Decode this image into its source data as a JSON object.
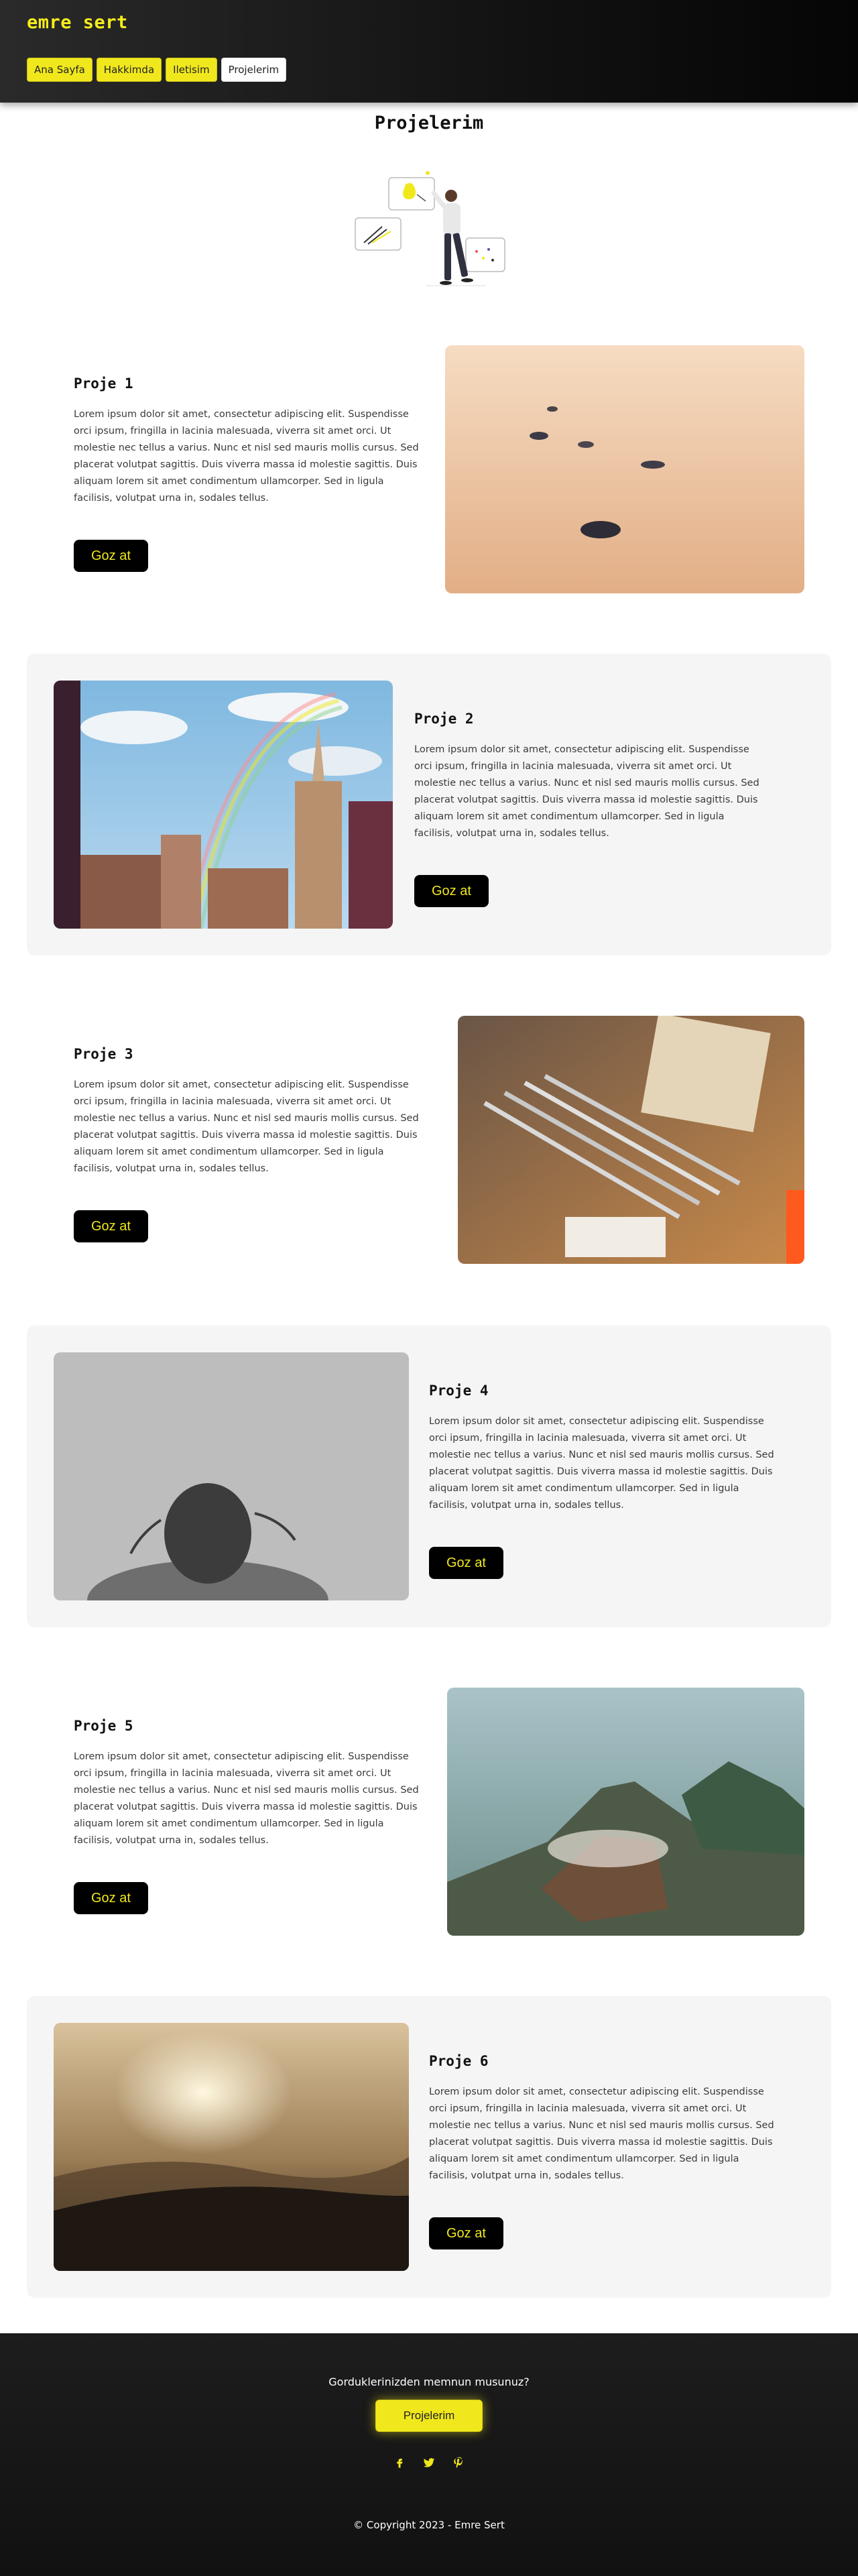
{
  "header": {
    "brand": "emre sert",
    "nav": [
      {
        "label": "Ana Sayfa"
      },
      {
        "label": "Hakkimda"
      },
      {
        "label": "Iletisim"
      },
      {
        "label": "Projelerim"
      }
    ]
  },
  "main": {
    "title": "Projelerim",
    "projects": [
      {
        "title": "Proje 1",
        "description": "Lorem ipsum dolor sit amet, consectetur adipiscing elit. Suspendisse orci ipsum, fringilla in lacinia malesuada, viverra sit amet orci. Ut molestie nec tellus a varius. Nunc et nisl sed mauris mollis cursus. Sed placerat volutpat sagittis. Duis viverra massa id molestie sagittis. Duis aliquam lorem sit amet condimentum ullamcorper. Sed in ligula facilisis, volutpat urna in, sodales tellus.",
        "button": "Goz at",
        "image": "sand-stones"
      },
      {
        "title": "Proje 2",
        "description": "Lorem ipsum dolor sit amet, consectetur adipiscing elit. Suspendisse orci ipsum, fringilla in lacinia malesuada, viverra sit amet orci. Ut molestie nec tellus a varius. Nunc et nisl sed mauris mollis cursus. Sed placerat volutpat sagittis. Duis viverra massa id molestie sagittis. Duis aliquam lorem sit amet condimentum ullamcorper. Sed in ligula facilisis, volutpat urna in, sodales tellus.",
        "button": "Goz at",
        "image": "city-rainbow"
      },
      {
        "title": "Proje 3",
        "description": "Lorem ipsum dolor sit amet, consectetur adipiscing elit. Suspendisse orci ipsum, fringilla in lacinia malesuada, viverra sit amet orci. Ut molestie nec tellus a varius. Nunc et nisl sed mauris mollis cursus. Sed placerat volutpat sagittis. Duis viverra massa id molestie sagittis. Duis aliquam lorem sit amet condimentum ullamcorper. Sed in ligula facilisis, volutpat urna in, sodales tellus.",
        "button": "Goz at",
        "image": "pens-desk"
      },
      {
        "title": "Proje 4",
        "description": "Lorem ipsum dolor sit amet, consectetur adipiscing elit. Suspendisse orci ipsum, fringilla in lacinia malesuada, viverra sit amet orci. Ut molestie nec tellus a varius. Nunc et nisl sed mauris mollis cursus. Sed placerat volutpat sagittis. Duis viverra massa id molestie sagittis. Duis aliquam lorem sit amet condimentum ullamcorper. Sed in ligula facilisis, volutpat urna in, sodales tellus.",
        "button": "Goz at",
        "image": "sad-person"
      },
      {
        "title": "Proje 5",
        "description": "Lorem ipsum dolor sit amet, consectetur adipiscing elit. Suspendisse orci ipsum, fringilla in lacinia malesuada, viverra sit amet orci. Ut molestie nec tellus a varius. Nunc et nisl sed mauris mollis cursus. Sed placerat volutpat sagittis. Duis viverra massa id molestie sagittis. Duis aliquam lorem sit amet condimentum ullamcorper. Sed in ligula facilisis, volutpat urna in, sodales tellus.",
        "button": "Goz at",
        "image": "volcano"
      },
      {
        "title": "Proje 6",
        "description": "Lorem ipsum dolor sit amet, consectetur adipiscing elit. Suspendisse orci ipsum, fringilla in lacinia malesuada, viverra sit amet orci. Ut molestie nec tellus a varius. Nunc et nisl sed mauris mollis cursus. Sed placerat volutpat sagittis. Duis viverra massa id molestie sagittis. Duis aliquam lorem sit amet condimentum ullamcorper. Sed in ligula facilisis, volutpat urna in, sodales tellus.",
        "button": "Goz at",
        "image": "hazy-sunset"
      }
    ]
  },
  "footer": {
    "question": "Gorduklerinizden memnun musunuz?",
    "button": "Projelerim",
    "socials": [
      "facebook-icon",
      "twitter-icon",
      "pinterest-icon"
    ],
    "copyright": "© Copyright 2023 - Emre Sert"
  },
  "colors": {
    "accent": "#f0e81d",
    "dark": "#000000",
    "section_gray": "#f5f5f5"
  }
}
